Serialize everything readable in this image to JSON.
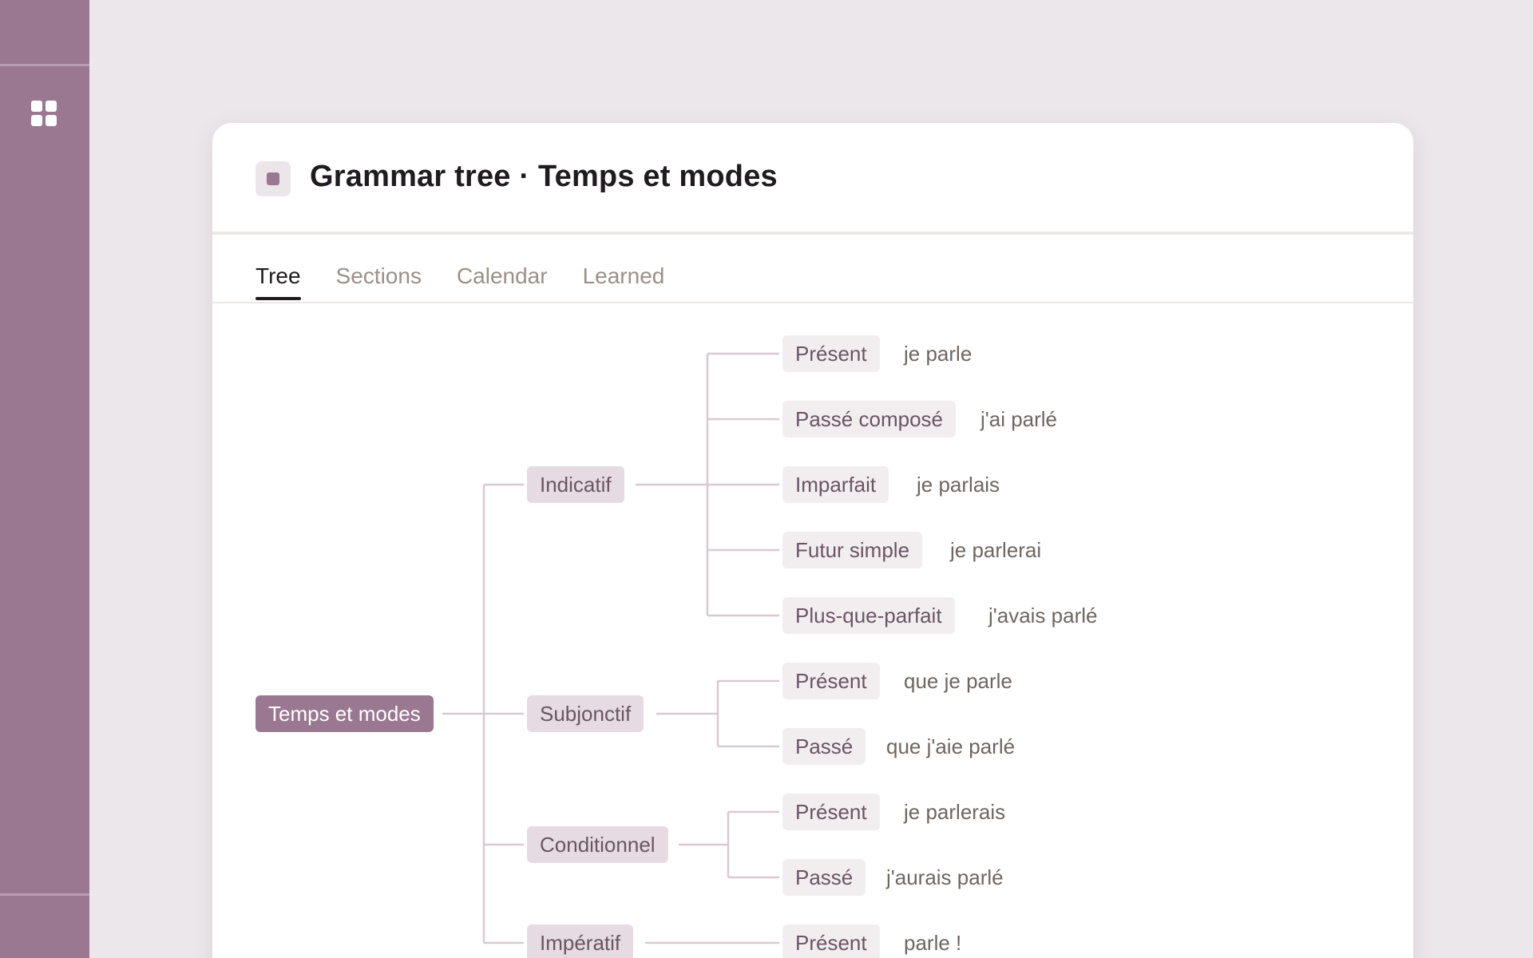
{
  "sidebar": {
    "menu_icon": "grid-icon"
  },
  "header": {
    "title": "Grammar tree · Temps et modes",
    "icon": "document-icon"
  },
  "tabs": [
    {
      "label": "Tree",
      "active": true
    },
    {
      "label": "Sections",
      "active": false
    },
    {
      "label": "Calendar",
      "active": false
    },
    {
      "label": "Learned",
      "active": false
    }
  ],
  "tree": {
    "root": "Temps et modes",
    "modes": [
      {
        "label": "Indicatif",
        "tenses": [
          {
            "label": "Présent",
            "example": "je parle"
          },
          {
            "label": "Passé composé",
            "example": "j'ai parlé"
          },
          {
            "label": "Imparfait",
            "example": "je parlais"
          },
          {
            "label": "Futur simple",
            "example": "je parlerai"
          },
          {
            "label": "Plus-que-parfait",
            "example": "j'avais parlé"
          }
        ]
      },
      {
        "label": "Subjonctif",
        "tenses": [
          {
            "label": "Présent",
            "example": "que je parle"
          },
          {
            "label": "Passé",
            "example": "que j'aie parlé"
          }
        ]
      },
      {
        "label": "Conditionnel",
        "tenses": [
          {
            "label": "Présent",
            "example": "je parlerais"
          },
          {
            "label": "Passé",
            "example": "j'aurais parlé"
          }
        ]
      },
      {
        "label": "Impératif",
        "tenses": [
          {
            "label": "Présent",
            "example": "parle !"
          }
        ]
      }
    ]
  },
  "colors": {
    "accent": "#9a7892",
    "mode_bg": "#e6dbe2",
    "tense_bg": "#f2eef0",
    "connector": "#d9c9d3"
  }
}
